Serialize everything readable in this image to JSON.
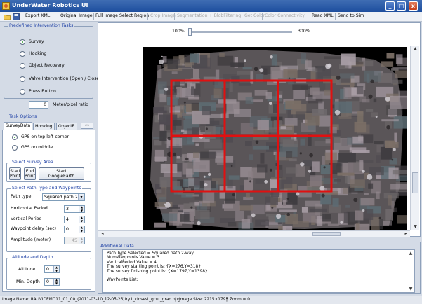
{
  "window": {
    "title": "UnderWater Robotics UI",
    "controls": [
      "_",
      "□",
      "x"
    ]
  },
  "toolbar": {
    "items": [
      {
        "label": "Export XML",
        "enabled": true
      },
      {
        "label": "Original Image",
        "enabled": true
      },
      {
        "label": "Full Image",
        "enabled": true
      },
      {
        "label": "Select Region",
        "enabled": true
      },
      {
        "label": "Crop Image",
        "enabled": false
      },
      {
        "label": "Segmentation + BlobFiltering",
        "enabled": false
      },
      {
        "label": "Get Color",
        "enabled": false
      },
      {
        "label": "Color Connectivity",
        "enabled": false
      },
      {
        "label": "Read XML",
        "enabled": true
      },
      {
        "label": "Send to Sim",
        "enabled": true
      }
    ]
  },
  "intervention": {
    "title": "Predefined Intervention Tasks",
    "options": [
      "Survey",
      "Hooking",
      "Object Recovery",
      "Valve Intervention (Open / Close)",
      "Press Button"
    ],
    "selected": "Survey"
  },
  "meter_ratio": {
    "value": "0",
    "label": "Meter/pixel ratio"
  },
  "task_options": {
    "title": "Task Options",
    "tabs": [
      "SurveyData",
      "Hooking",
      "ObjectR"
    ],
    "active_tab": "SurveyData",
    "tab_arrows": "◂ ▸"
  },
  "gps": {
    "options": [
      "GPS on top left corner",
      "GPS on middle"
    ],
    "selected": "GPS on top left corner"
  },
  "survey_area": {
    "title": "Select Survey Area",
    "buttons": {
      "start": "Start\nPoint",
      "end": "End\nPoint",
      "google": "Start\nGoogleEarth"
    }
  },
  "path": {
    "title": "Select Path Type and Waypoints",
    "type_label": "Path type",
    "type_value": "Squared path 2-",
    "fields": [
      {
        "label": "Horizontal Period",
        "value": "3",
        "enabled": true
      },
      {
        "label": "Vertical Period",
        "value": "4",
        "enabled": true
      },
      {
        "label": "Waypoint delay (sec)",
        "value": "0",
        "enabled": true
      },
      {
        "label": "Amplitude (meter)",
        "value": "45",
        "enabled": false
      }
    ]
  },
  "altitude": {
    "title": "Altitude and Depth",
    "fields": [
      {
        "label": "Altitude",
        "value": "0"
      },
      {
        "label": "Min. Depth",
        "value": "0"
      }
    ]
  },
  "zoom": {
    "min_label": "100%",
    "max_label": "300%",
    "level": 0.0
  },
  "image": {
    "grid_rows": 2,
    "grid_cols": 3,
    "grid_color": "#e01010",
    "seabed_colors": [
      "#6f6a6c",
      "#8a7f84",
      "#4e4a50",
      "#a99ea6",
      "#5d6c73",
      "#3f3c40",
      "#7b6f66",
      "#9a8f96"
    ]
  },
  "additional": {
    "title": "Additional Data",
    "lines": [
      "Path Type Selected = Squared path 2-way",
      "NumWaypoints.Value = 3",
      "VerticalPeriod.Value = 4",
      "The survey starting point is:  {X=276,Y=318}",
      "The survey finishing point is:  {X=1797,Y=1398}",
      "",
      "WayPoints List:"
    ]
  },
  "statusbar": {
    "image_name": "Image Name: RAUVIDEMO11_01_00_(2011-03-10_12-05-26)fry1_closest_gcut_grad.png",
    "image_size": "Image Size: 2215×1795",
    "zoom": "Zoom = 0"
  }
}
